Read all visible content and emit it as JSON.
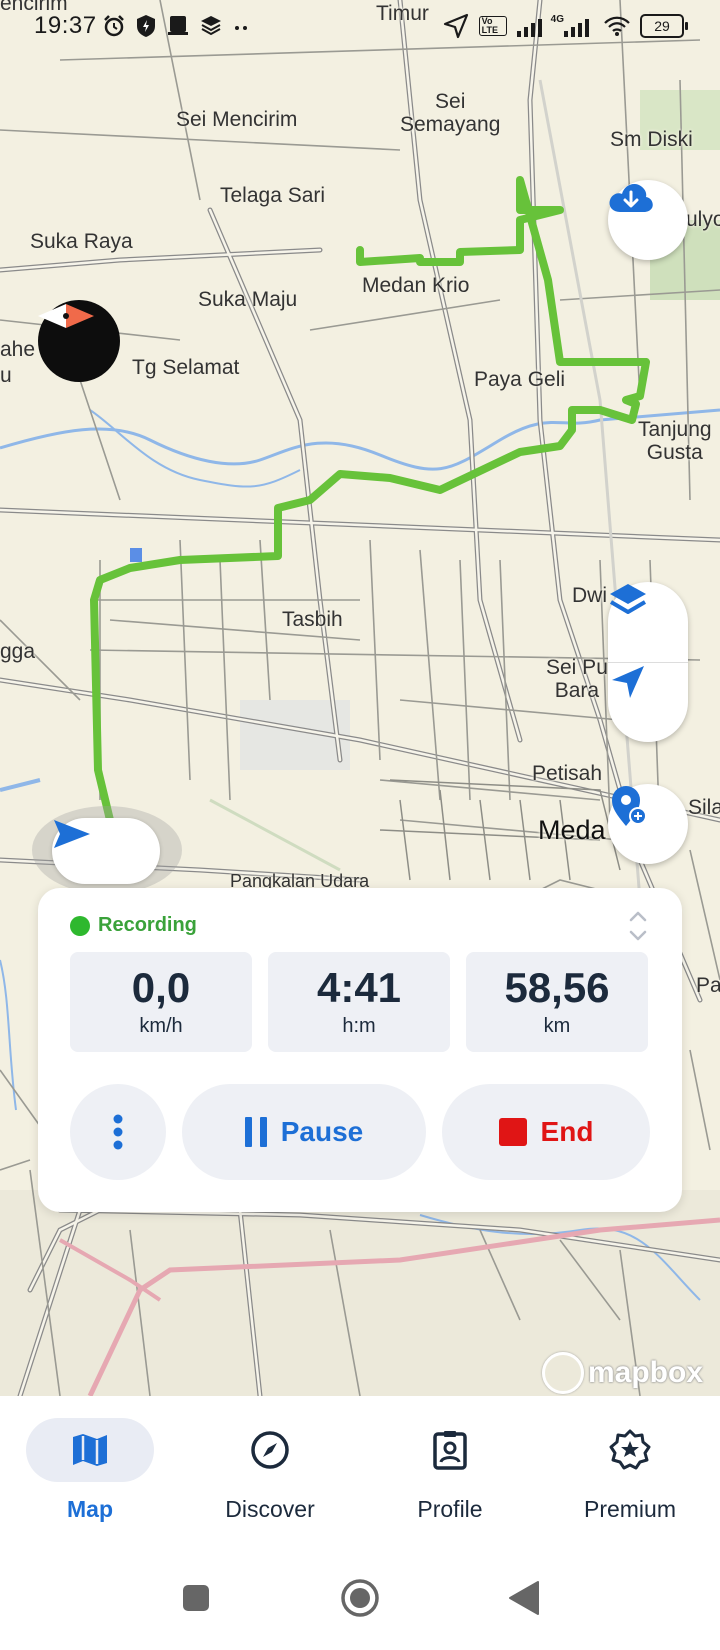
{
  "status_bar": {
    "time": "19:37",
    "left_icons": [
      "alarm-icon",
      "shield-icon",
      "notification-icon",
      "layers-icon",
      "more-dots-icon"
    ],
    "network_label": "4G",
    "volte_label": "Vo LTE",
    "battery": "29"
  },
  "map": {
    "places": {
      "timur": "Timur",
      "encirim": "encirim",
      "sei_mencirim": "Sei Mencirim",
      "sei_semayang": "Sei\nSemayang",
      "sm_diski": "Sm Diski",
      "telaga_sari": "Telaga Sari",
      "suka_raya": "Suka Raya",
      "medan_krio": "Medan Krio",
      "suka_maju": "Suka Maju",
      "tg_selamat": "Tg Selamat",
      "ahe": "ahe",
      "u": "u",
      "paya_geli": "Paya Geli",
      "tanjung_gusta": "Tanjung\nGusta",
      "tasbih": "Tasbih",
      "dwi": "Dwi",
      "gga": "gga",
      "sei_pu_bara": "Sei Pu\nBara",
      "petisah": "Petisah",
      "meda": "Meda",
      "sila": "Sila",
      "pa": "Pa",
      "pangkalan_udara": "Pangkalan Udara",
      "sulyo": "ulyo"
    },
    "route_color": "#67c23a",
    "attribution": "mapbox",
    "buttons": {
      "download": "download-cloud-icon",
      "layers": "layers-icon",
      "locate": "navigation-arrow-icon",
      "add_poi": "add-location-icon",
      "compass": "compass-icon"
    }
  },
  "recording_card": {
    "status_label": "Recording",
    "status_color": "#2eb82e",
    "stats": [
      {
        "value": "0,0",
        "unit": "km/h"
      },
      {
        "value": "4:41",
        "unit": "h:m"
      },
      {
        "value": "58,56",
        "unit": "km"
      }
    ],
    "more_label": "more-vertical-icon",
    "pause_label": "Pause",
    "end_label": "End",
    "pause_color": "#1d6fd6",
    "end_color": "#e01515"
  },
  "bottom_nav": {
    "items": [
      {
        "label": "Map",
        "icon": "map-icon",
        "active": true
      },
      {
        "label": "Discover",
        "icon": "compass-icon",
        "active": false
      },
      {
        "label": "Profile",
        "icon": "profile-icon",
        "active": false
      },
      {
        "label": "Premium",
        "icon": "star-badge-icon",
        "active": false
      }
    ],
    "active_color": "#1d6fd6"
  },
  "system_nav": [
    "recents-square-icon",
    "home-circle-icon",
    "back-triangle-icon"
  ]
}
